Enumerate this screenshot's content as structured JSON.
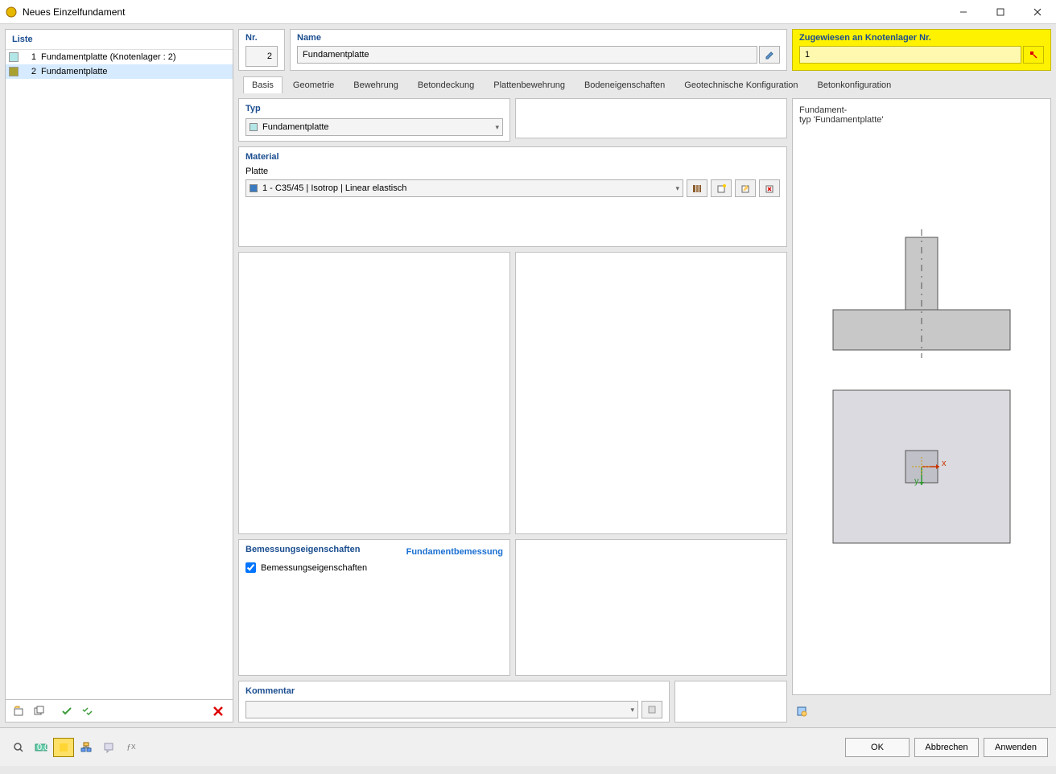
{
  "window": {
    "title": "Neues Einzelfundament"
  },
  "list": {
    "header": "Liste",
    "items": [
      {
        "num": "1",
        "label": "Fundamentplatte (Knotenlager : 2)",
        "color": "#b3e6e6"
      },
      {
        "num": "2",
        "label": "Fundamentplatte",
        "color": "#a8a030"
      }
    ]
  },
  "fields": {
    "nr_label": "Nr.",
    "nr_value": "2",
    "name_label": "Name",
    "name_value": "Fundamentplatte",
    "assigned_label": "Zugewiesen an Knotenlager Nr.",
    "assigned_value": "1"
  },
  "tabs": [
    "Basis",
    "Geometrie",
    "Bewehrung",
    "Betondeckung",
    "Plattenbewehrung",
    "Bodeneigenschaften",
    "Geotechnische Konfiguration",
    "Betonkonfiguration"
  ],
  "typ": {
    "header": "Typ",
    "value": "Fundamentplatte"
  },
  "material": {
    "header": "Material",
    "sub": "Platte",
    "value": "1 - C35/45 | Isotrop | Linear elastisch"
  },
  "design": {
    "header": "Bemessungseigenschaften",
    "link": "Fundamentbemessung",
    "chk_label": "Bemessungseigenschaften"
  },
  "comment": {
    "header": "Kommentar",
    "value": ""
  },
  "preview": {
    "line1": "Fundament-",
    "line2": "typ 'Fundamentplatte'"
  },
  "buttons": {
    "ok": "OK",
    "cancel": "Abbrechen",
    "apply": "Anwenden"
  }
}
